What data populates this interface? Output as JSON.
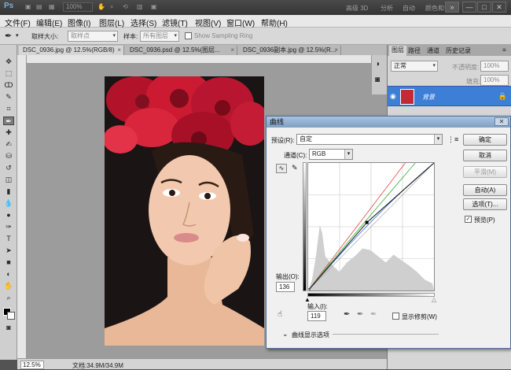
{
  "app": {
    "logo": "Ps",
    "zoom_display": "100%",
    "workspaces": [
      "高级 3D",
      "分析",
      "自动",
      "颜色和色调"
    ],
    "more_symbol": "»",
    "win_controls": [
      "—",
      "□",
      "✕"
    ]
  },
  "menu": [
    "文件(F)",
    "编辑(E)",
    "图像(I)",
    "图层(L)",
    "选择(S)",
    "滤镜(T)",
    "视图(V)",
    "窗口(W)",
    "帮助(H)"
  ],
  "options": {
    "sample_size_label": "取样大小:",
    "sample_size_value": "取样点",
    "sample_label": "样本:",
    "sample_value": "所有图层",
    "show_ring_label": "Show Sampling Ring"
  },
  "doc_tabs": [
    {
      "label": "DSC_0936.jpg @ 12.5%(RGB/8)",
      "close": "×"
    },
    {
      "label": "DSC_0936.psd @ 12.5%(图层...",
      "close": "×"
    },
    {
      "label": "DSC_0936副本.jpg @ 12.5%(R...",
      "close": "×"
    }
  ],
  "status": {
    "zoom": "12.5%",
    "doc_info": "文档:34.9M/34.9M"
  },
  "layers_panel": {
    "tabs": [
      "图层",
      "路径",
      "通道",
      "历史记录"
    ],
    "blend_mode": "正常",
    "opacity_label": "不透明度:",
    "opacity_value": "100%",
    "fill_label": "填充:",
    "fill_value": "100%",
    "layer_name": "背景"
  },
  "curves": {
    "title": "曲线",
    "close": "✕",
    "preset_label": "预设(R):",
    "preset_value": "自定",
    "channel_label": "通道(C):",
    "channel_value": "RGB",
    "output_label": "输出(O):",
    "output_value": "136",
    "input_label": "输入(I):",
    "input_value": "119",
    "show_clipping_label": "显示修剪(W)",
    "display_options_label": "曲线显示选项",
    "buttons": {
      "ok": "确定",
      "cancel": "取消",
      "smooth": "平滑(M)",
      "auto": "自动(A)",
      "options": "选项(T)...",
      "preview": "预览(P)"
    },
    "preview_checked": true,
    "curve_point": {
      "input": 119,
      "output": 136
    },
    "colors": {
      "red_curve": "#e04040",
      "green_curve": "#30b030",
      "blue_curve": "#3070e0",
      "histogram": "#cfcfcf"
    }
  }
}
